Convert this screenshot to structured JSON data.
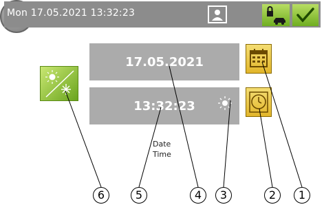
{
  "header": {
    "datetime": "Mon 17.05.2021  13:32:23"
  },
  "fields": {
    "date_value": "17.05.2021",
    "time_value": "13:32:23"
  },
  "labels": {
    "date": "Date",
    "time": "Time"
  },
  "callouts": [
    "6",
    "5",
    "4",
    "3",
    "2",
    "1"
  ],
  "icons": {
    "user": "user-icon",
    "lock_car": "lock-car-icon",
    "check": "check-icon",
    "sun": "sun-icon",
    "calendar": "calendar-icon",
    "clock": "clock-icon",
    "season": "sun-snowflake-icon",
    "home": "home-icon"
  },
  "colors": {
    "header": "#8c8c8c",
    "field": "#ababab",
    "accent_green": "#7ab730",
    "accent_yellow": "#e8c23a"
  }
}
